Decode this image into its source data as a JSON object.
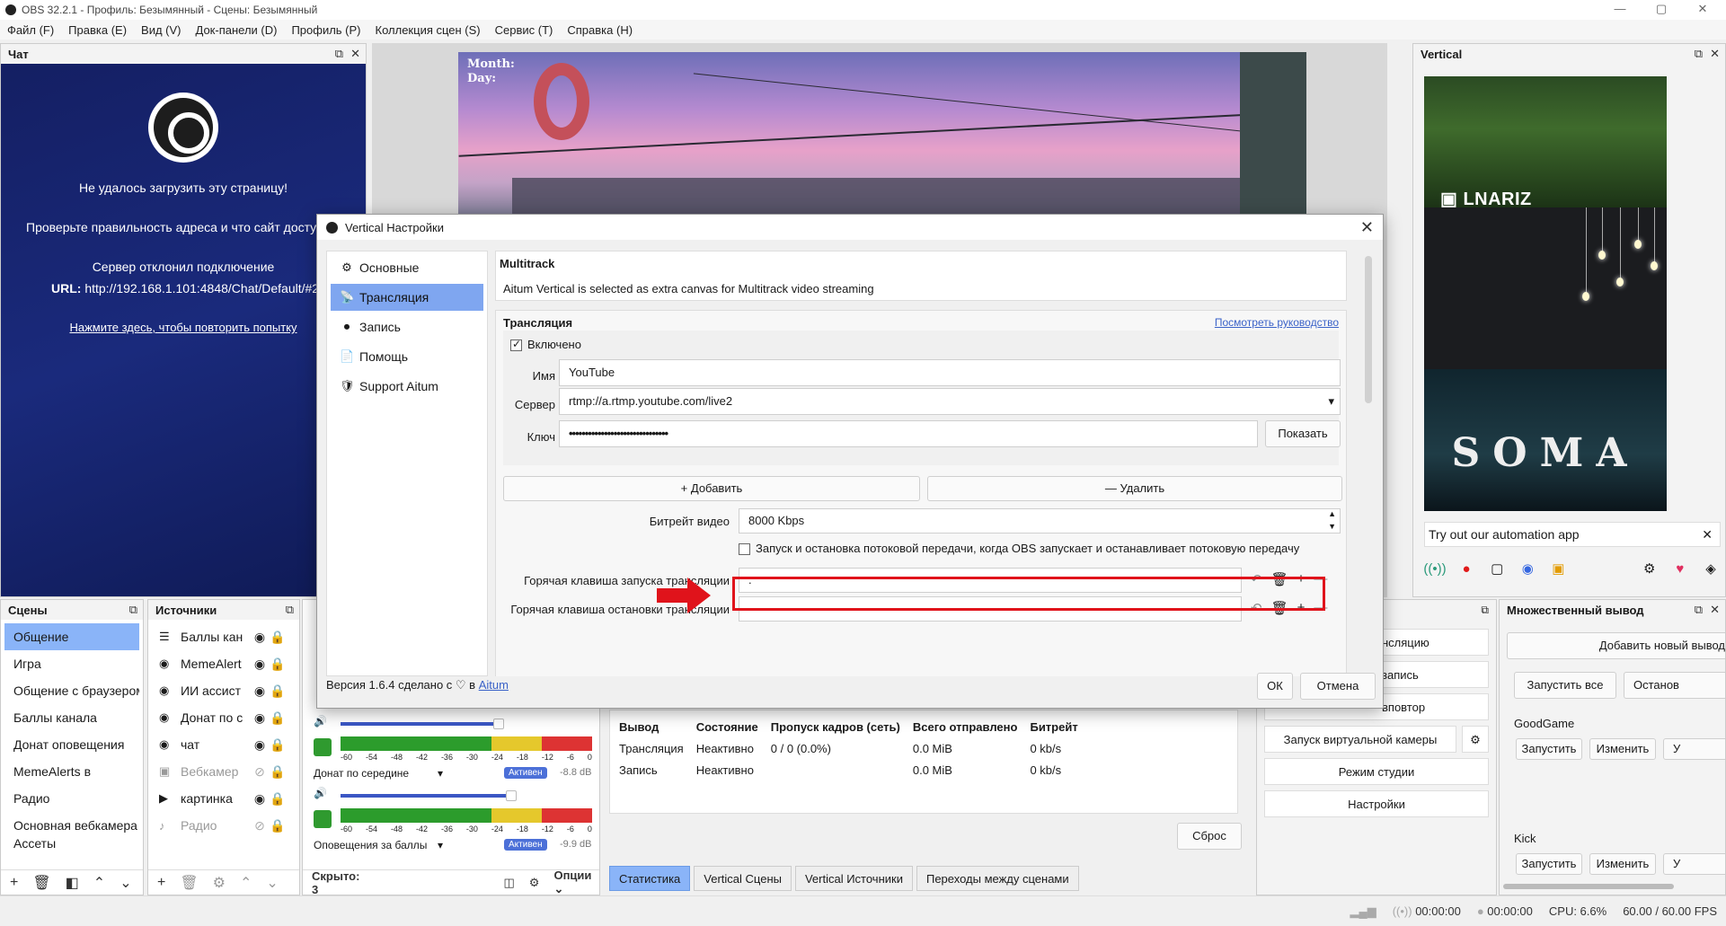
{
  "window": {
    "title": "OBS 32.2.1 - Профиль: Безымянный - Сцены: Безымянный"
  },
  "menu": [
    "Файл (F)",
    "Правка (E)",
    "Вид (V)",
    "Док-панели (D)",
    "Профиль (P)",
    "Коллекция сцен (S)",
    "Сервис (T)",
    "Справка (H)"
  ],
  "chat": {
    "title": "Чат",
    "error": "Не удалось загрузить эту страницу!",
    "check": "Проверьте правильность адреса и что сайт досту",
    "refused": "Сервер отклонил подключение",
    "url_label": "URL:",
    "url": "http://192.168.1.101:4848/Chat/Default/#2",
    "retry": "Нажмите здесь, чтобы повторить попытку"
  },
  "preview": {
    "overlay_line1": "Month:",
    "overlay_line2": "Day:"
  },
  "vertical": {
    "title": "Vertical",
    "streamer": "LNARIZ",
    "game": "SOMA",
    "automation": "Try out our automation app"
  },
  "scenes": {
    "title": "Сцены",
    "items": [
      "Общение",
      "Игра",
      "Общение с браузером",
      "Баллы канала",
      "Донат оповещения",
      "MemeAlerts в",
      "Радио",
      "Основная вебкамера",
      "Ассеты"
    ]
  },
  "sources": {
    "title": "Источники",
    "items": [
      {
        "icon": "☰",
        "name": "Баллы кан",
        "hidden": false
      },
      {
        "icon": "◉",
        "name": "MemeAlert",
        "hidden": false
      },
      {
        "icon": "◉",
        "name": "ИИ ассист",
        "hidden": false
      },
      {
        "icon": "◉",
        "name": "Донат по с",
        "hidden": false
      },
      {
        "icon": "◉",
        "name": "чат",
        "hidden": false
      },
      {
        "icon": "▣",
        "name": "Вебкамер",
        "hidden": true
      },
      {
        "icon": "▶",
        "name": "картинка",
        "hidden": false
      },
      {
        "icon": "♪",
        "name": "Радио",
        "hidden": true
      }
    ]
  },
  "mixer": {
    "tracks": [
      {
        "name": "Донат по середине",
        "status": "Активен",
        "db": "-8.8 dB"
      },
      {
        "name": "Оповещения за баллы",
        "status": "Активен",
        "db": "-9.9 dB"
      }
    ],
    "scale": [
      "-60",
      "-54",
      "-48",
      "-42",
      "-36",
      "-30",
      "-24",
      "-18",
      "-12",
      "-6",
      "0"
    ],
    "hidden_label": "Скрыто: 3",
    "options": "Опции"
  },
  "stats": {
    "headers": [
      "Вывод",
      "Состояние",
      "Пропуск кадров (сеть)",
      "Всего отправлено",
      "Битрейт"
    ],
    "rows": [
      [
        "Трансляция",
        "Неактивно",
        "0 / 0 (0.0%)",
        "0.0 MiB",
        "0 kb/s"
      ],
      [
        "Запись",
        "Неактивно",
        "",
        "0.0 MiB",
        "0 kb/s"
      ]
    ],
    "reset": "Сброс"
  },
  "tabs": [
    "Статистика",
    "Vertical Сцены",
    "Vertical Источники",
    "Переходы между сценами"
  ],
  "controls": {
    "partial1": "нсляцию",
    "partial2": "запись",
    "partial3": "вповтор",
    "virtual_cam": "Запуск виртуальной камеры",
    "studio": "Режим студии",
    "settings": "Настройки"
  },
  "multi": {
    "title": "Множественный вывод",
    "add": "Добавить новый вывод",
    "start_all": "Запустить все",
    "stop_all": "Останов",
    "outputs": [
      {
        "name": "GoodGame",
        "start": "Запустить",
        "edit": "Изменить",
        "extra": "У"
      },
      {
        "name": "Kick",
        "start": "Запустить",
        "edit": "Изменить",
        "extra": "У"
      }
    ]
  },
  "statusbar": {
    "stream_time": "00:00:00",
    "rec_time": "00:00:00",
    "cpu": "CPU: 6.6%",
    "fps": "60.00 / 60.00 FPS"
  },
  "dialog": {
    "title": "Vertical Настройки",
    "nav": [
      {
        "icon": "⚙",
        "label": "Основные"
      },
      {
        "icon": "📡",
        "label": "Трансляция"
      },
      {
        "icon": "⏺",
        "label": "Запись"
      },
      {
        "icon": "📄",
        "label": "Помощь"
      },
      {
        "icon": "🛡",
        "label": "Support Aitum"
      }
    ],
    "multitrack_title": "Multitrack",
    "multitrack_desc": "Aitum Vertical is selected as extra canvas for Multitrack video streaming",
    "stream_section": "Трансляция",
    "guide_link": "Посмотреть руководство",
    "enabled": "Включено",
    "name_label": "Имя",
    "name_value": "YouTube",
    "server_label": "Сервер",
    "server_value": "rtmp://a.rtmp.youtube.com/live2",
    "key_label": "Ключ",
    "key_value": "•••••••••••••••••••••••••••••••",
    "show": "Показать",
    "add": "Добавить",
    "remove": "Удалить",
    "bitrate_label": "Битрейт видео",
    "bitrate_value": "8000 Kbps",
    "sync_option": "Запуск и остановка потоковой передачи, когда OBS запускает и останавливает потоковую передачу",
    "hotkey_start": "Горячая клавиша запуска трансляции",
    "hotkey_start_value": ".",
    "hotkey_stop": "Горячая клавиша остановки трансляции",
    "version_text": "Версия 1.6.4 сделано с ♡ в",
    "version_link": "Aitum",
    "ok": "ОК",
    "cancel": "Отмена"
  },
  "colors": {
    "highlight": "#e0131b",
    "accent": "#7fa6f0",
    "chat_bg": "#1a2a7c"
  }
}
